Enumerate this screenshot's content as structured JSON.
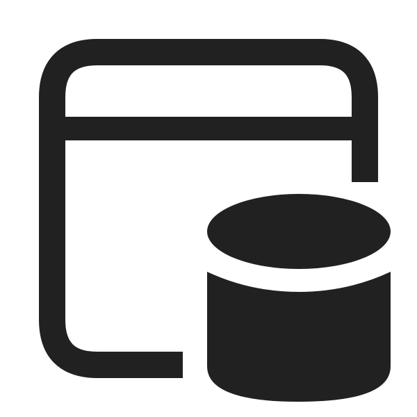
{
  "icon": {
    "name": "app-window-database-icon",
    "color": "#212121",
    "background": "#ffffff"
  }
}
